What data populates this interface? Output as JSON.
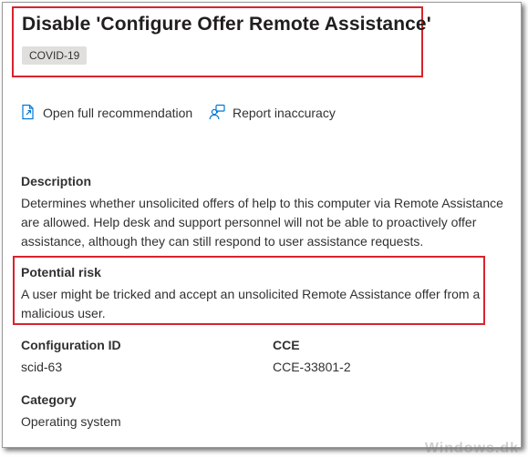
{
  "header": {
    "title": "Disable 'Configure Offer Remote Assistance'",
    "tag": "COVID-19"
  },
  "actions": {
    "open_label": "Open full recommendation",
    "report_label": "Report inaccuracy"
  },
  "description": {
    "label": "Description",
    "lines": [
      "Determines whether unsolicited offers of help to this computer via Remote Assistance",
      "are allowed. Help desk and support personnel will not be able to proactively offer",
      "assistance, although they can still respond to user assistance requests."
    ]
  },
  "risk": {
    "label": "Potential risk",
    "lines": [
      "A user might be tricked and accept an unsolicited Remote Assistance offer from a",
      "malicious user."
    ]
  },
  "details": {
    "config_label": "Configuration ID",
    "config_value": "scid-63",
    "cce_label": "CCE",
    "cce_value": "CCE-33801-2",
    "category_label": "Category",
    "category_value": "Operating system"
  },
  "watermark": "Windows.dk",
  "colors": {
    "highlight_border": "#d9232e",
    "tag_background": "#e1dfdd",
    "text": "#323130"
  }
}
